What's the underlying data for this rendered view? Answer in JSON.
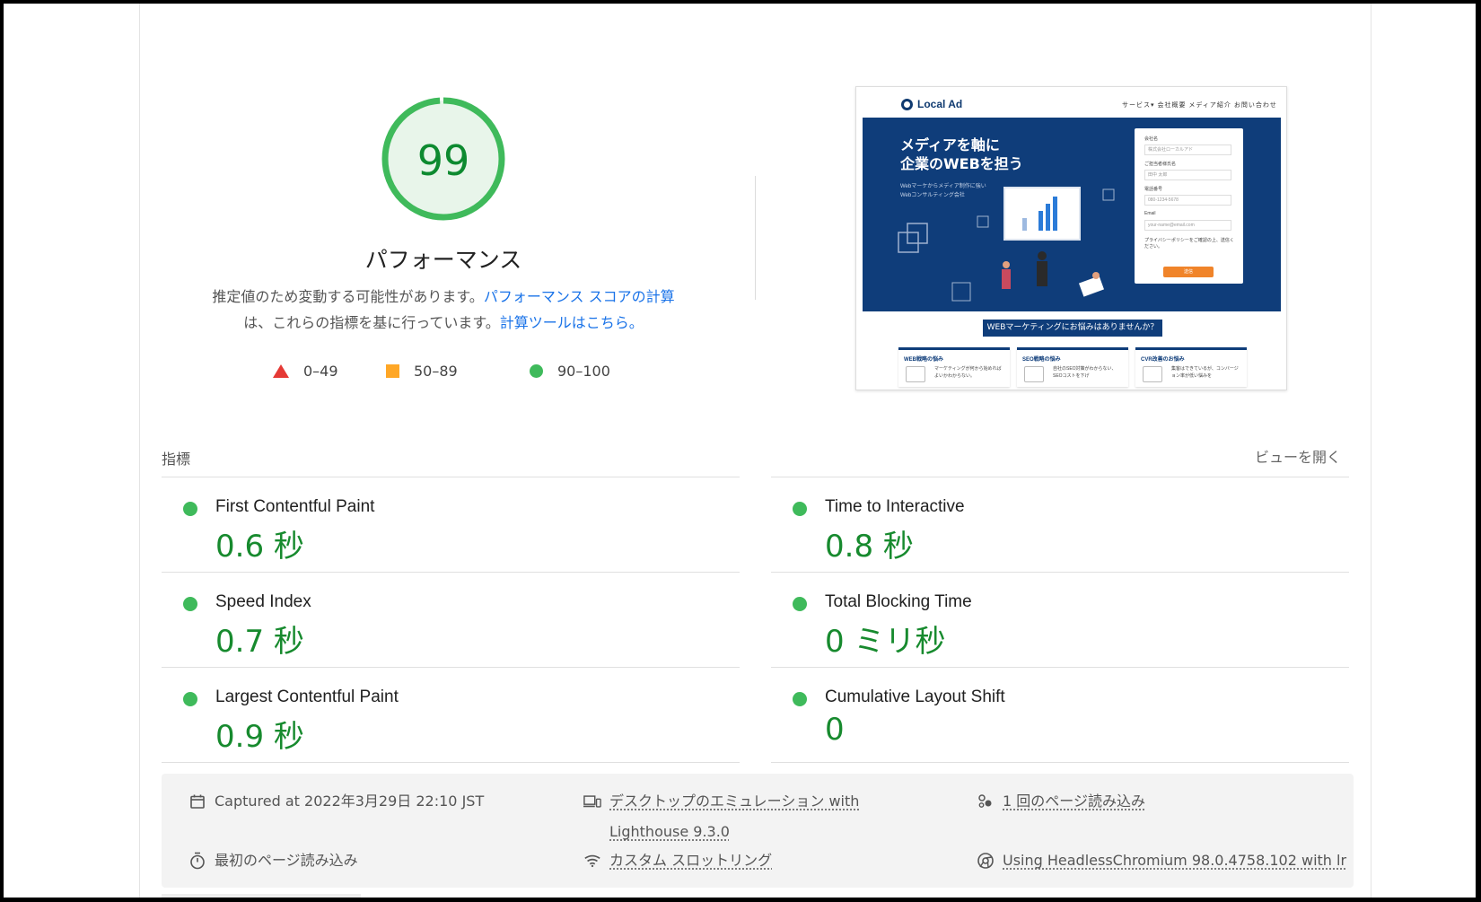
{
  "gauge": {
    "score": "99",
    "score_value": 99,
    "title": "パフォーマンス",
    "color": "#0cce6b"
  },
  "description": {
    "text1": "推定値のため変動する可能性があります。",
    "link1": "パフォーマンス スコアの計算",
    "text2": "は、これらの指標を基に行っています。",
    "link2": "計算ツールはこちら。"
  },
  "legend": [
    {
      "range": "0–49",
      "shape": "triangle",
      "color": "#e53935"
    },
    {
      "range": "50–89",
      "shape": "square",
      "color": "#ffa726"
    },
    {
      "range": "90–100",
      "shape": "circle",
      "color": "#3fba5b"
    }
  ],
  "thumbnail": {
    "logo": "Local Ad",
    "nav": "サービス▾ 会社概要 メディア紹介 お問い合わせ",
    "headline1": "メディアを軸に",
    "headline2": "企業のWEBを担う",
    "subtext": "Webマーケからメディア制作に強いWebコンサルティング会社",
    "form": {
      "label1": "会社名",
      "value1": "株式会社ローカルアド",
      "label2": "ご担当者様氏名",
      "value2": "田中 太郎",
      "label3": "電話番号",
      "value3": "080-1234-5678",
      "label4": "Email",
      "value4": "your-name@email.com",
      "note": "プライバシーポリシーをご確認の上、送信ください。",
      "submit": "送信"
    },
    "banner": "WEBマーケティングにお悩みはありませんか？",
    "cards": [
      {
        "title": "WEB戦略の悩み",
        "body": "マーケティングが何から始めればよいかわからない。"
      },
      {
        "title": "SEO戦略の悩み",
        "body": "自社のSEO対策がわからない、SEOコストを下げ"
      },
      {
        "title": "CVR改善のお悩み",
        "body": "集客はできているが、コンバージョン率が低い悩みを"
      }
    ]
  },
  "metrics": {
    "label": "指標",
    "toggle": "ビューを開く",
    "items": [
      {
        "name": "First Contentful Paint",
        "value": "0.6 秒"
      },
      {
        "name": "Time to Interactive",
        "value": "0.8 秒"
      },
      {
        "name": "Speed Index",
        "value": "0.7 秒"
      },
      {
        "name": "Total Blocking Time",
        "value": "0 ミリ秒"
      },
      {
        "name": "Largest Contentful Paint",
        "value": "0.9 秒"
      },
      {
        "name": "Cumulative Layout Shift",
        "value": "0"
      }
    ]
  },
  "info": {
    "captured": "Captured at 2022年3月29日 22:10 JST",
    "emulation_line1": "デスクトップのエミュレーション with",
    "emulation_line2": "Lighthouse 9.3.0",
    "page_loads": "1 回のページ読み込み",
    "initial_load": "最初のページ読み込み",
    "throttling": "カスタム スロットリング",
    "browser": "Using HeadlessChromium 98.0.4758.102 with lr"
  }
}
